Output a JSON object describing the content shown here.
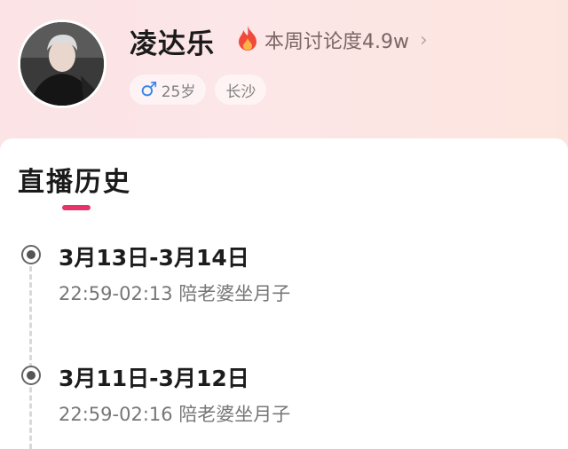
{
  "profile": {
    "name": "凌达乐",
    "heat_label": "本周讨论度4.9w",
    "gender_symbol": "♂",
    "age": "25岁",
    "location": "长沙"
  },
  "section": {
    "title": "直播历史"
  },
  "history": [
    {
      "date_range": "3月13日-3月14日",
      "time_range": "22:59-02:13",
      "topic": "陪老婆坐月子"
    },
    {
      "date_range": "3月11日-3月12日",
      "time_range": "22:59-02:16",
      "topic": "陪老婆坐月子"
    }
  ],
  "colors": {
    "accent": "#e8336a",
    "flame": "#f04a3a",
    "male": "#3a86e8"
  },
  "icons": {
    "heat": "flame-icon",
    "more": "chevron-right-icon",
    "gender": "male-icon",
    "entry": "radio-dot-icon"
  }
}
